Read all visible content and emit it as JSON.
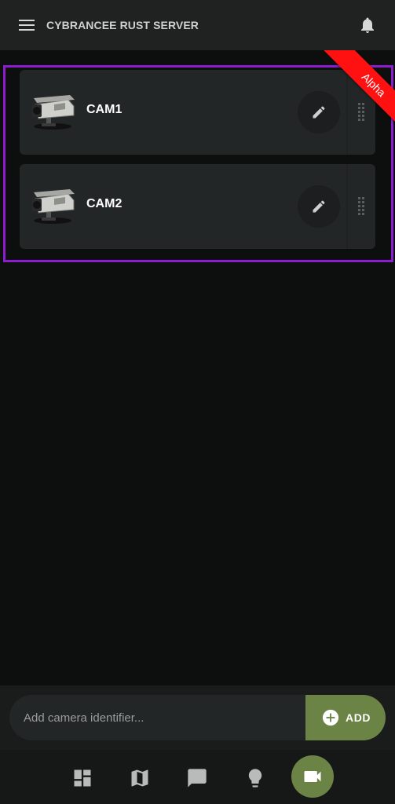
{
  "header": {
    "menu_icon": "hamburger-menu-icon",
    "title": "CYBRANCEE RUST SERVER",
    "notification_icon": "bell-icon"
  },
  "ribbon": {
    "label": "Alpha",
    "color": "#ff1111"
  },
  "highlight_color": "#8e1ccf",
  "cameras": [
    {
      "name": "CAM1",
      "icon": "security-camera-icon",
      "edit_icon": "pencil-icon",
      "drag_icon": "drag-handle-icon"
    },
    {
      "name": "CAM2",
      "icon": "security-camera-icon",
      "edit_icon": "pencil-icon",
      "drag_icon": "drag-handle-icon"
    }
  ],
  "add_camera": {
    "placeholder": "Add camera identifier...",
    "value": "",
    "button_label": "ADD",
    "button_icon": "plus-circle-icon",
    "accent": "#6b8446"
  },
  "bottom_nav": {
    "items": [
      {
        "icon": "dashboard-icon",
        "active": false
      },
      {
        "icon": "map-icon",
        "active": false
      },
      {
        "icon": "chat-icon",
        "active": false
      },
      {
        "icon": "lightbulb-icon",
        "active": false
      },
      {
        "icon": "video-camera-icon",
        "active": true
      }
    ]
  }
}
